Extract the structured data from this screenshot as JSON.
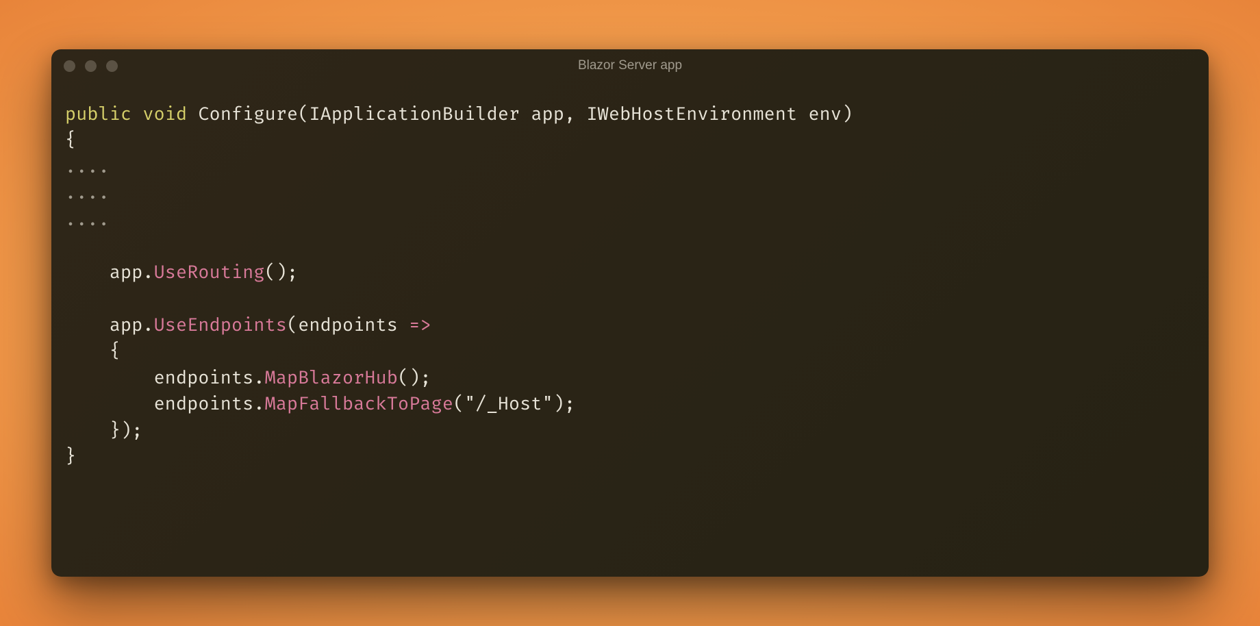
{
  "window": {
    "title": "Blazor Server app"
  },
  "code": {
    "kw_public": "public",
    "kw_void": "void",
    "fn_configure": "Configure",
    "type_iappbuilder": "IApplicationBuilder",
    "param_app": "app",
    "sep_comma": ", ",
    "type_iwebhostenv": "IWebHostEnvironment",
    "param_env": "env",
    "paren_open": "(",
    "paren_close": ")",
    "brace_open": "{",
    "brace_close": "}",
    "dots": "....",
    "var_app": "app",
    "dot": ".",
    "m_userouting": "UseRouting",
    "empty_parens": "()",
    "semi": ";",
    "m_useendpoints": "UseEndpoints",
    "param_endpoints": "endpoints",
    "arrow": "=>",
    "var_endpoints": "endpoints",
    "m_mapblazorhub": "MapBlazorHub",
    "m_mapfallback": "MapFallbackToPage",
    "str_host": "\"/_Host\"",
    "close_fn": "});"
  }
}
